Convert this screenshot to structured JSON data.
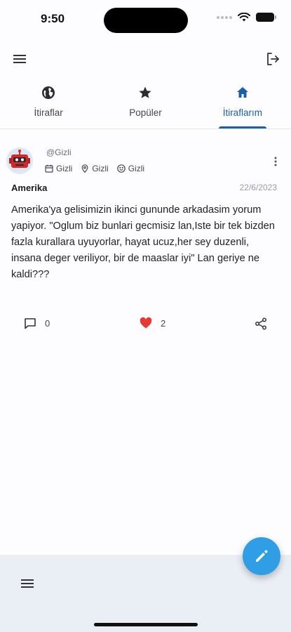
{
  "status": {
    "time": "9:50"
  },
  "toolbar": {
    "menu_icon": "menu-icon",
    "logout_icon": "logout-icon"
  },
  "tabs": [
    {
      "label": "İtiraflar",
      "icon": "globe-icon",
      "active": false
    },
    {
      "label": "Popüler",
      "icon": "star-icon",
      "active": false
    },
    {
      "label": "İtiraflarım",
      "icon": "home-icon",
      "active": true
    }
  ],
  "post": {
    "username": "@Gizli",
    "meta": [
      {
        "icon": "calendar-icon",
        "text": "Gizli"
      },
      {
        "icon": "location-icon",
        "text": "Gizli"
      },
      {
        "icon": "smiley-icon",
        "text": "Gizli"
      }
    ],
    "title": "Amerika",
    "date": "22/6/2023",
    "body": "Amerika'ya gelisimizin ikinci gununde arkadasim yorum yapiyor. \"Oglum biz bunlari gecmisiz lan,Iste bir tek bizden fazla kurallara uyuyorlar, hayat ucuz,her sey duzenli, insana deger veriliyor, bir de maaslar iyi\" Lan geriye ne kaldi???",
    "comments": "0",
    "likes": "2"
  },
  "colors": {
    "accent": "#1a5fa8",
    "fab": "#2f9ee4",
    "heart": "#e53935",
    "bottom_bar": "#eaeef5"
  }
}
